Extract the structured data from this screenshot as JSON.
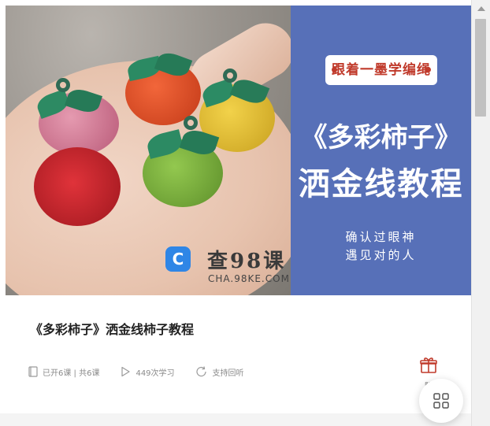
{
  "banner": {
    "tag": "跟着一墨学编绳",
    "headline_line1": "《多彩柿子》",
    "headline_line2": "洒金线教程",
    "slogan_line1": "确认过眼神",
    "slogan_line2": "遇见对的人",
    "watermark_name": "查98课",
    "watermark_url": "CHA.98KE.COM",
    "watermark_logo": "C",
    "side_color": "#5770b8"
  },
  "course": {
    "title": "《多彩柿子》洒金线柿子教程",
    "lessons": "已开6课 | 共6课",
    "learners": "449次学习",
    "replay": "支持回听",
    "gift_label": "赠"
  },
  "icons": {
    "lessons": "book-icon",
    "learners": "play-icon",
    "replay": "refresh-icon",
    "gift": "gift-icon",
    "fab": "grid-icon"
  },
  "colors": {
    "accent": "#c03a2b",
    "muted": "#8a8a8a"
  }
}
